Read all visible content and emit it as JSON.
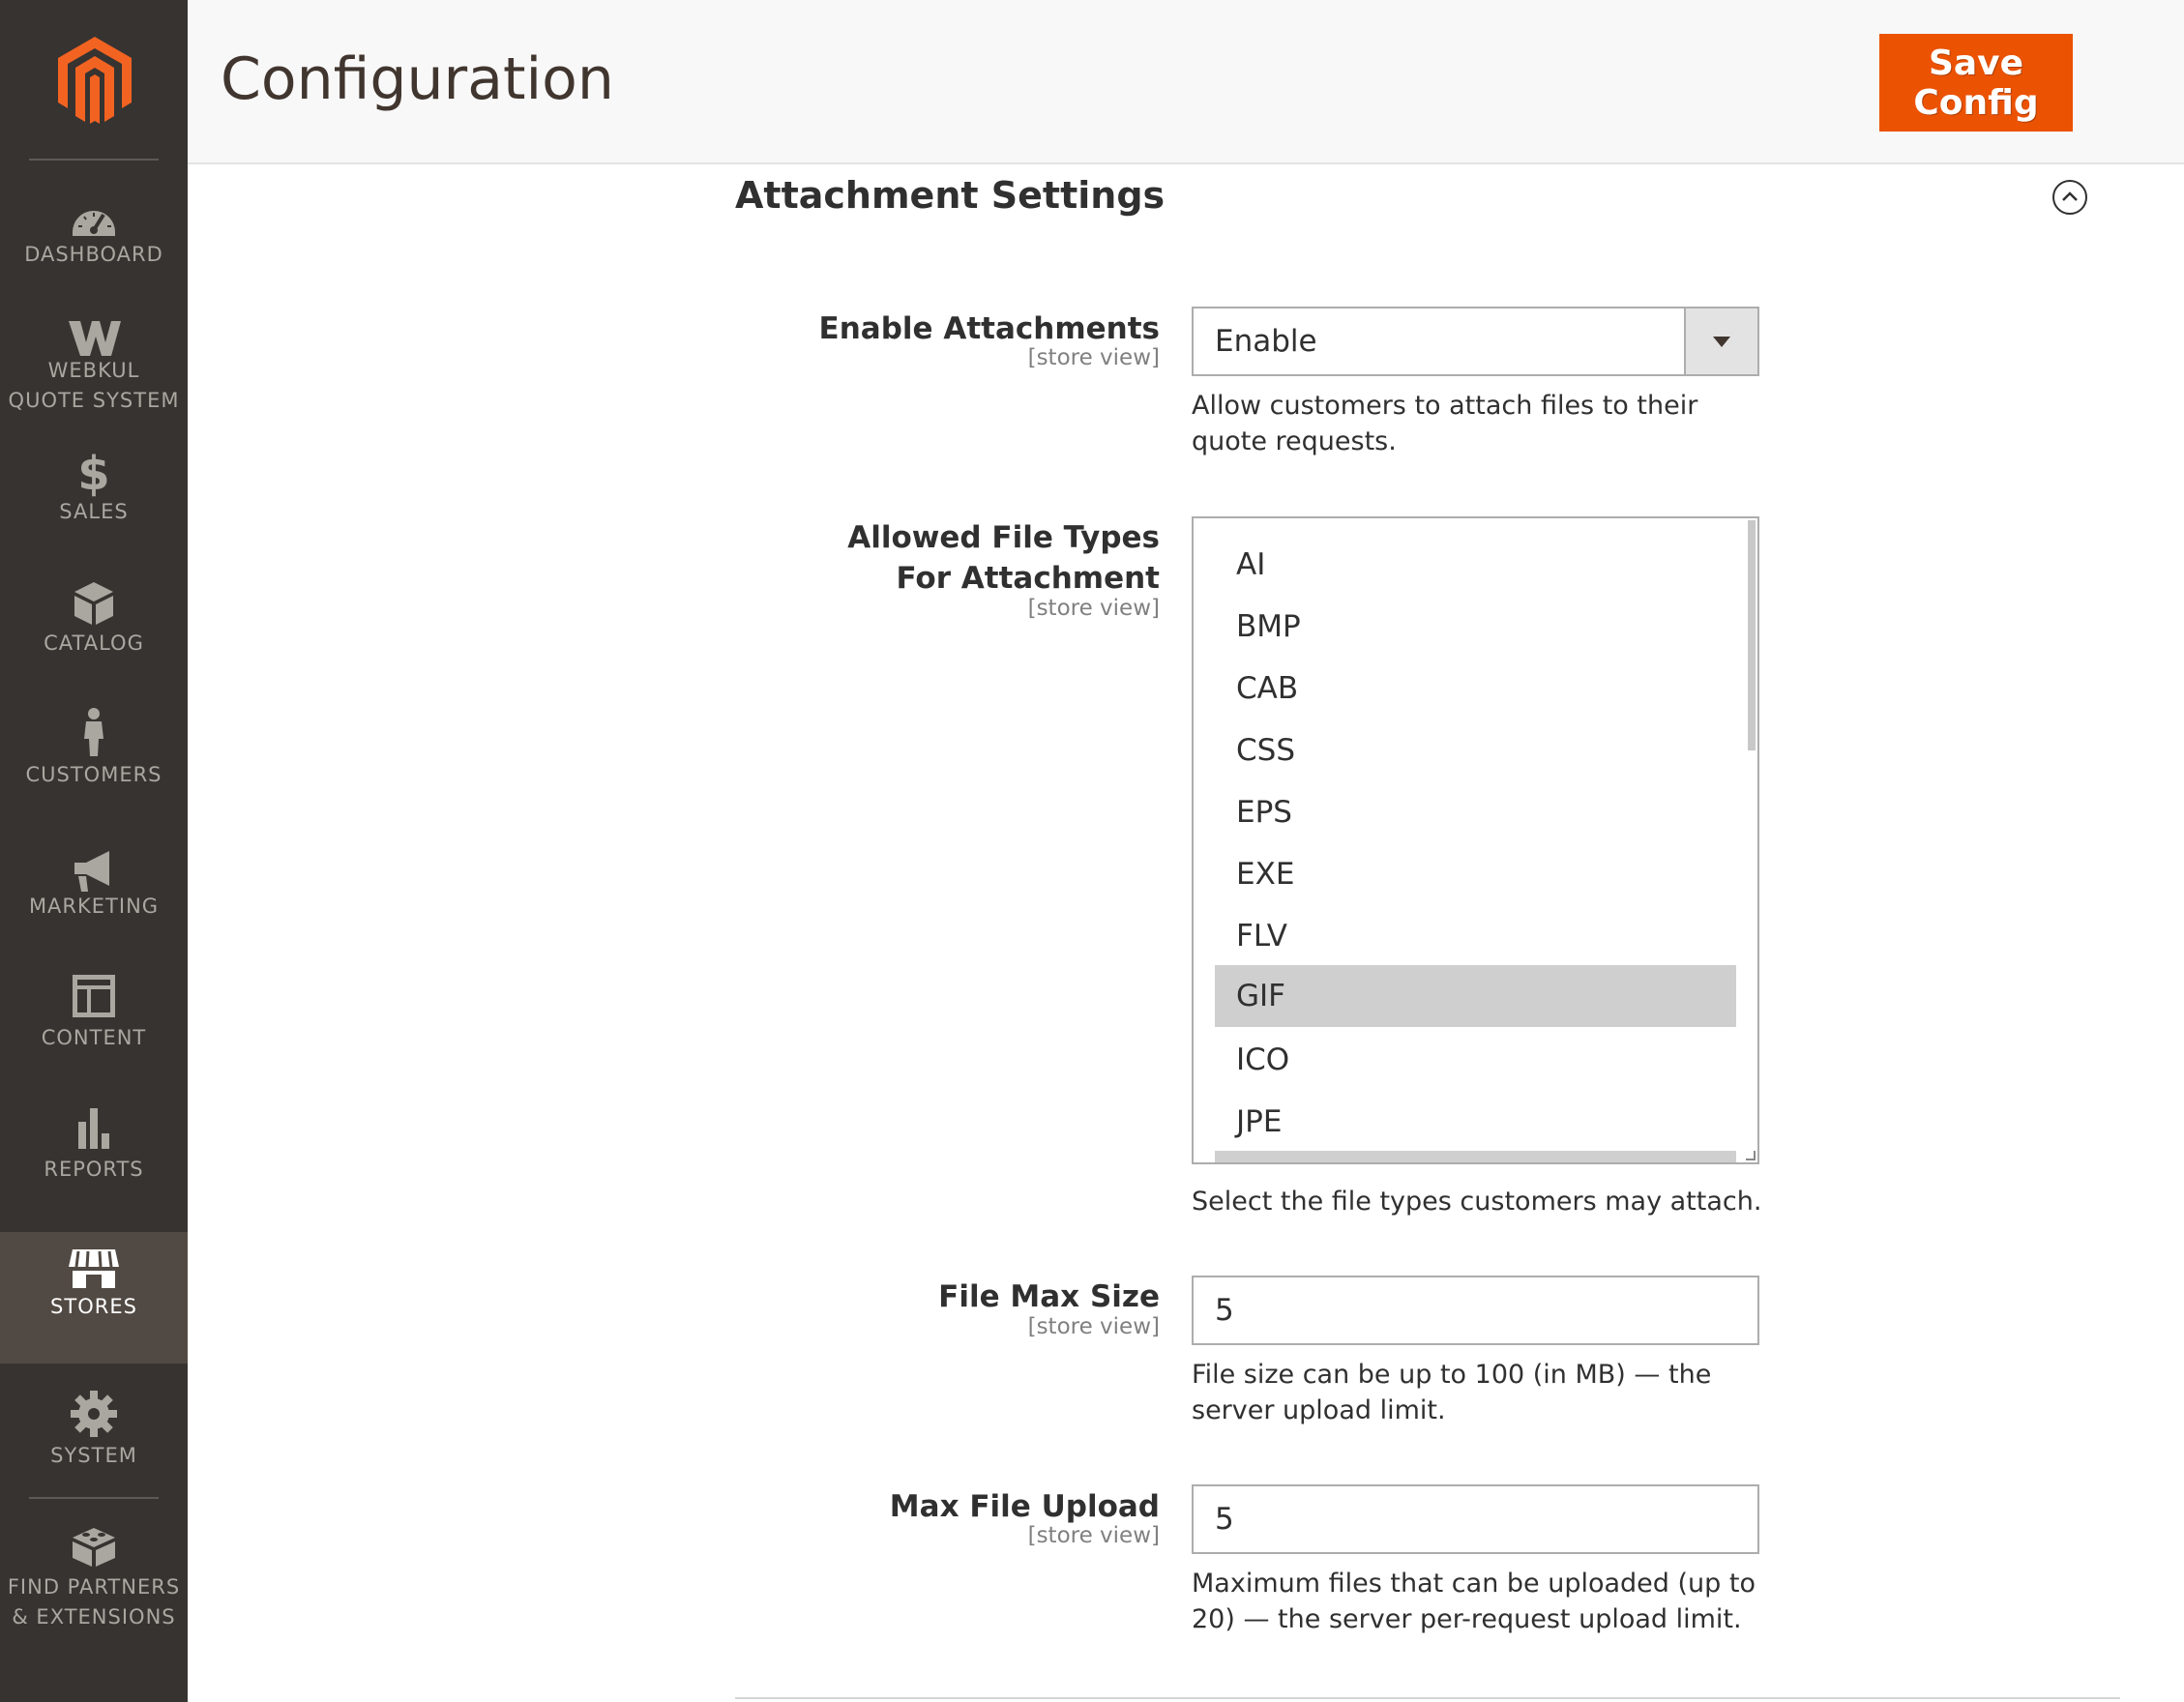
{
  "sidebar": {
    "logo": "magento-logo",
    "items": [
      {
        "label": "DASHBOARD",
        "icon": "dashboard-gauge-icon"
      },
      {
        "label": "WEBKUL\nQUOTE SYSTEM",
        "icon": "webkul-w-icon"
      },
      {
        "label": "SALES",
        "icon": "dollar-icon"
      },
      {
        "label": "CATALOG",
        "icon": "box-icon"
      },
      {
        "label": "CUSTOMERS",
        "icon": "person-icon"
      },
      {
        "label": "MARKETING",
        "icon": "megaphone-icon"
      },
      {
        "label": "CONTENT",
        "icon": "layout-icon"
      },
      {
        "label": "REPORTS",
        "icon": "bar-chart-icon"
      },
      {
        "label": "STORES",
        "icon": "storefront-icon",
        "active": true
      },
      {
        "label": "SYSTEM",
        "icon": "gear-icon"
      },
      {
        "label": "FIND PARTNERS\n& EXTENSIONS",
        "icon": "blocks-icon"
      }
    ]
  },
  "header": {
    "title": "Configuration",
    "save_label": "Save Config"
  },
  "section": {
    "title": "Attachment Settings",
    "collapse_icon": "chevron-up-circle-icon"
  },
  "fields": {
    "enable_attachments": {
      "label": "Enable Attachments",
      "scope": "[store view]",
      "value": "Enable",
      "note": "Allow customers to attach files to their quote requests."
    },
    "allowed_file_types": {
      "label": "Allowed File Types For Attachment",
      "scope": "[store view]",
      "options": [
        "AI",
        "BMP",
        "CAB",
        "CSS",
        "EPS",
        "EXE",
        "FLV",
        "GIF",
        "ICO",
        "JPE"
      ],
      "selected": [
        "GIF"
      ],
      "note": "Select the file types customers may attach."
    },
    "file_max_size": {
      "label": "File Max Size",
      "scope": "[store view]",
      "value": "5",
      "note": "File size can be up to 100 (in MB) — the server upload limit."
    },
    "max_file_upload": {
      "label": "Max File Upload",
      "scope": "[store view]",
      "value": "5",
      "note": "Maximum files that can be uploaded (up to 20) — the server per-request upload limit."
    }
  },
  "colors": {
    "sidebar_bg": "#373330",
    "sidebar_active_bg": "#514943",
    "accent": "#eb5202",
    "logo_orange": "#f26322"
  }
}
